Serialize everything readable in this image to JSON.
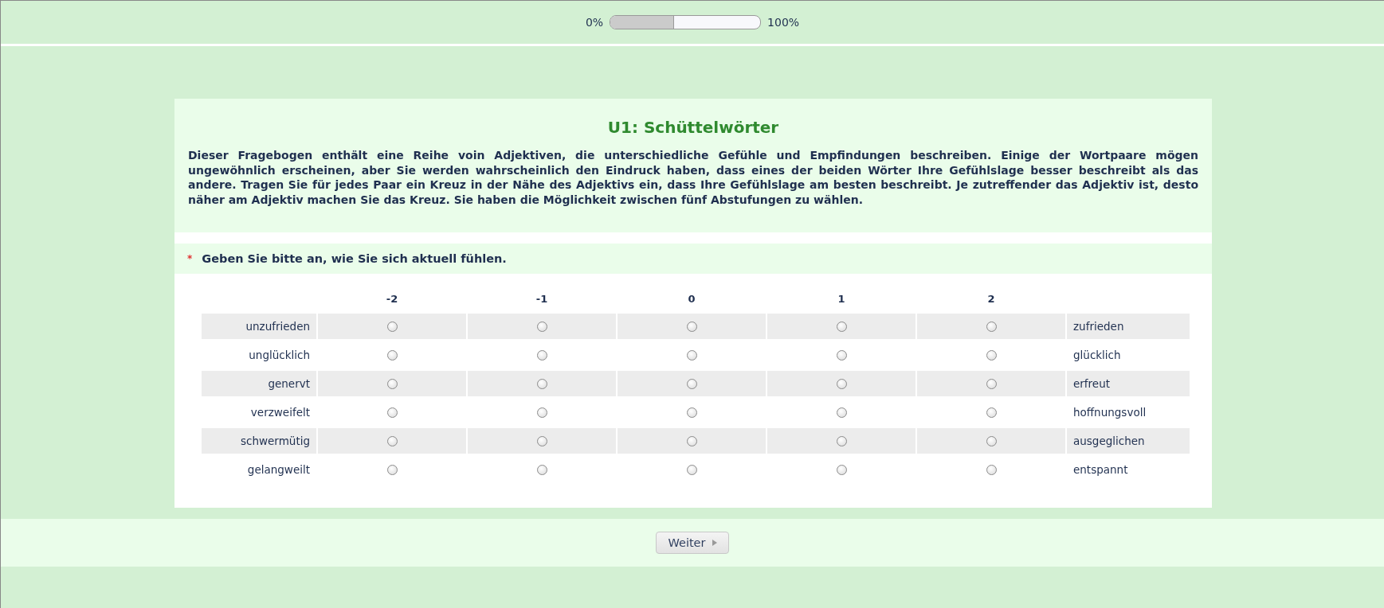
{
  "progress": {
    "start_label": "0%",
    "end_label": "100%",
    "level": 0.42
  },
  "intro": {
    "title": "U1: Schüttelwörter",
    "text": "Dieser Fragebogen enthält eine Reihe voin Adjektiven, die unterschiedliche Gefühle und Empfindungen beschreiben. Einige der Wortpaare mögen ungewöhnlich erscheinen, aber Sie werden wahrscheinlich den Eindruck haben, dass eines der beiden Wörter Ihre Gefühlslage besser beschreibt als das andere. Tragen Sie für jedes Paar ein Kreuz in der Nähe des Adjektivs ein, dass Ihre Gefühlslage am besten beschreibt. Je zutreffender das Adjektiv ist, desto näher am Adjektiv machen Sie das Kreuz. Sie haben die Möglichkeit zwischen fünf Abstufungen zu wählen."
  },
  "question": {
    "required_mark": "*",
    "text": "Geben Sie bitte an, wie Sie sich aktuell fühlen.",
    "columns": [
      "-2",
      "-1",
      "0",
      "1",
      "2"
    ],
    "rows": [
      {
        "left": "unzufrieden",
        "right": "zufrieden",
        "choices": [
          {
            "selected": false
          },
          {
            "selected": false
          },
          {
            "selected": false
          },
          {
            "selected": false
          },
          {
            "selected": false
          }
        ]
      },
      {
        "left": "unglücklich",
        "right": "glücklich",
        "choices": [
          {
            "selected": false
          },
          {
            "selected": false
          },
          {
            "selected": false
          },
          {
            "selected": false
          },
          {
            "selected": false
          }
        ]
      },
      {
        "left": "genervt",
        "right": "erfreut",
        "choices": [
          {
            "selected": false
          },
          {
            "selected": false
          },
          {
            "selected": false
          },
          {
            "selected": false
          },
          {
            "selected": false
          }
        ]
      },
      {
        "left": "verzweifelt",
        "right": "hoffnungsvoll",
        "choices": [
          {
            "selected": false
          },
          {
            "selected": false
          },
          {
            "selected": false
          },
          {
            "selected": false
          },
          {
            "selected": false
          }
        ]
      },
      {
        "left": "schwermütig",
        "right": "ausgeglichen",
        "choices": [
          {
            "selected": false
          },
          {
            "selected": false
          },
          {
            "selected": false
          },
          {
            "selected": false
          },
          {
            "selected": false
          }
        ]
      },
      {
        "left": "gelangweilt",
        "right": "entspannt",
        "choices": [
          {
            "selected": false
          },
          {
            "selected": false
          },
          {
            "selected": false
          },
          {
            "selected": false
          },
          {
            "selected": false
          }
        ]
      }
    ]
  },
  "next_button": {
    "label": "Weiter"
  }
}
